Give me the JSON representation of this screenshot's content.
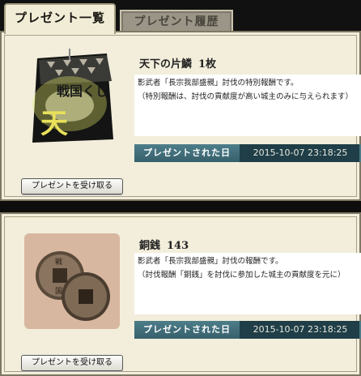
{
  "tabs": {
    "active": "プレゼント一覧",
    "inactive": "プレゼント履歴"
  },
  "gifts": [
    {
      "name": "天下の片鱗",
      "quantity": "1枚",
      "desc_line1": "影武者「長宗我部盛親」討伐の特別報酬です。",
      "desc_line2": "（特別報酬は、討伐の貢献度が高い城主のみに与えられます）",
      "date_label": "プレゼントされた日",
      "date": "2015-10-07 23:18:25",
      "receive_label": "プレゼントを受け取る",
      "thumb_text": "戦国くじ",
      "thumb_big": "天"
    },
    {
      "name": "銅銭",
      "quantity": "143",
      "desc_line1": "影武者「長宗我部盛親」討伐の報酬です。",
      "desc_line2": "（討伐報酬「銅銭」を討伐に参加した城主の貢献度を元に）",
      "date_label": "プレゼントされた日",
      "date": "2015-10-07 23:18:25",
      "receive_label": "プレゼントを受け取る",
      "coin_text": [
        "戦",
        "国"
      ]
    }
  ]
}
